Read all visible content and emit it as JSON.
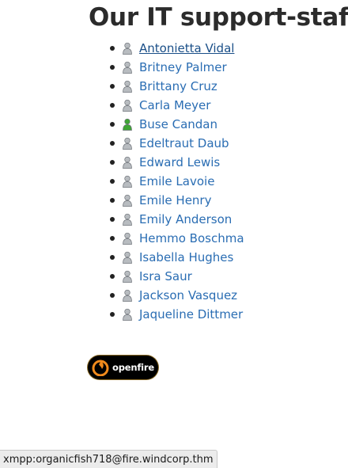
{
  "page": {
    "title": "Our IT support-staff"
  },
  "staff": [
    {
      "name": "Antonietta Vidal",
      "status": "offline",
      "hover": true
    },
    {
      "name": "Britney Palmer",
      "status": "offline"
    },
    {
      "name": "Brittany Cruz",
      "status": "offline"
    },
    {
      "name": "Carla Meyer",
      "status": "offline"
    },
    {
      "name": "Buse Candan",
      "status": "online"
    },
    {
      "name": "Edeltraut Daub",
      "status": "offline"
    },
    {
      "name": "Edward Lewis",
      "status": "offline"
    },
    {
      "name": "Emile Lavoie",
      "status": "offline"
    },
    {
      "name": "Emile Henry",
      "status": "offline"
    },
    {
      "name": "Emily Anderson",
      "status": "offline"
    },
    {
      "name": "Hemmo Boschma",
      "status": "offline"
    },
    {
      "name": "Isabella Hughes",
      "status": "offline"
    },
    {
      "name": "Isra Saur",
      "status": "offline"
    },
    {
      "name": "Jackson Vasquez",
      "status": "offline"
    },
    {
      "name": "Jaqueline Dittmer",
      "status": "offline"
    }
  ],
  "badge": {
    "label": "openfire",
    "icon": "openfire-flame-icon"
  },
  "status_bar": {
    "link_url": "xmpp:organicfish718@fire.windcorp.thm"
  },
  "colors": {
    "link": "#2a6db3",
    "offline_icon": "#b8bcc0",
    "online_icon": "#3fa535",
    "badge_accent": "#f08a1c"
  }
}
